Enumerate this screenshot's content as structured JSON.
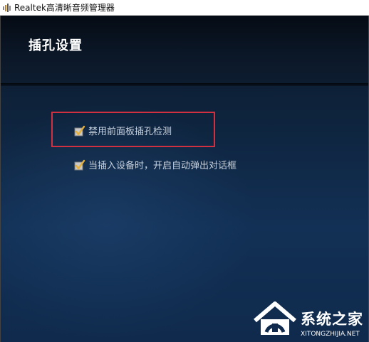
{
  "window": {
    "title": "Realtek高清晰音频管理器",
    "icon": "speaker-bars-icon"
  },
  "header": {
    "title": "插孔设置"
  },
  "options": [
    {
      "label": "禁用前面板插孔检测",
      "checked": true,
      "highlighted": true
    },
    {
      "label": "当插入设备时，开启自动弹出对话框",
      "checked": true,
      "highlighted": false
    }
  ],
  "watermark": {
    "name": "系统之家",
    "url": "XITONGZHIJIA.NET",
    "icon": "house-logo-icon"
  },
  "colors": {
    "background": "#0f2a4c",
    "header": "#0b1727",
    "highlight_border": "#d03040",
    "checkmark": "#e6b13a",
    "label_text": "#c8d2de"
  }
}
